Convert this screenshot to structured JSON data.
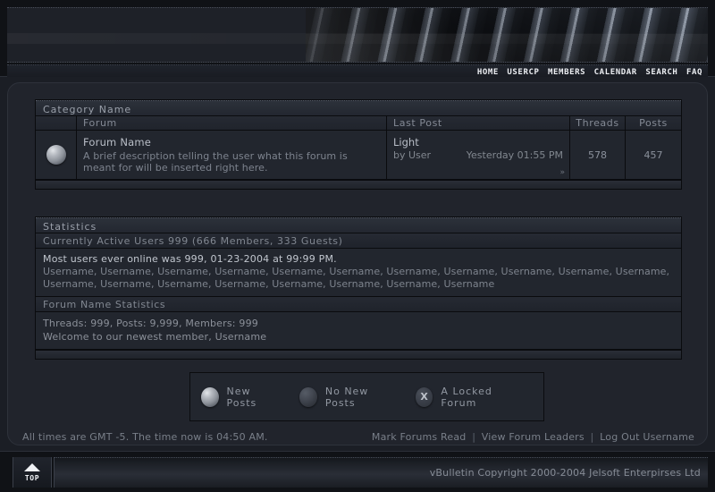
{
  "nav": {
    "links": [
      "HOME",
      "USERCP",
      "MEMBERS",
      "CALENDAR",
      "SEARCH",
      "FAQ"
    ]
  },
  "forum_table": {
    "category_title": "Category Name",
    "headers": {
      "icon": "",
      "forum": "Forum",
      "last_post": "Last Post",
      "threads": "Threads",
      "posts": "Posts"
    },
    "rows": [
      {
        "icon": "new-posts-sphere",
        "title": "Forum Name",
        "description": "A brief description telling the user what this forum is meant for will be inserted right here.",
        "last_post_title": "Light",
        "last_post_author": "by User",
        "last_post_time": "Yesterday 01:55 PM",
        "last_post_arrow": "»",
        "threads": "578",
        "posts": "457"
      }
    ]
  },
  "statistics": {
    "title": "Statistics",
    "active_users": "Currently Active Users 999 (666 Members, 333 Guests)",
    "most_ever": "Most users ever online was 999, 01-23-2004 at 99:99 PM.",
    "user_list": "Username, Username, Username, Username, Username, Username, Username, Username, Username, Username, Username, Username, Username, Username, Username, Username, Username, Username, Username",
    "forum_stats_title": "Forum Name Statistics",
    "counts": "Threads: 999, Posts: 9,999, Members: 999",
    "welcome": "Welcome to our newest member, Username"
  },
  "legend": {
    "items": [
      {
        "icon": "new-posts-sphere",
        "label": "New Posts"
      },
      {
        "icon": "no-new-posts-sphere",
        "label": "No New Posts"
      },
      {
        "icon": "locked-forum-icon",
        "label": "A Locked Forum",
        "glyph": "X"
      }
    ]
  },
  "footer": {
    "time_note": "All times are GMT -5. The time now is 04:50 AM.",
    "links": [
      "Mark Forums Read",
      "View Forum Leaders",
      "Log Out Username"
    ],
    "separator": "|",
    "top_button_label": "TOP",
    "copyright": "vBulletin Copyright 2000-2004 Jelsoft Enterpirses Ltd"
  },
  "colors": {
    "page_background": "#1b1e25",
    "panel_background": "#21242c",
    "row_background": "#22262e",
    "header_bar": "#262a33",
    "text_primary": "#b9bec7",
    "text_muted": "#7d838e",
    "nav_text": "#eceef2",
    "border_dark": "#0a0b0e"
  }
}
